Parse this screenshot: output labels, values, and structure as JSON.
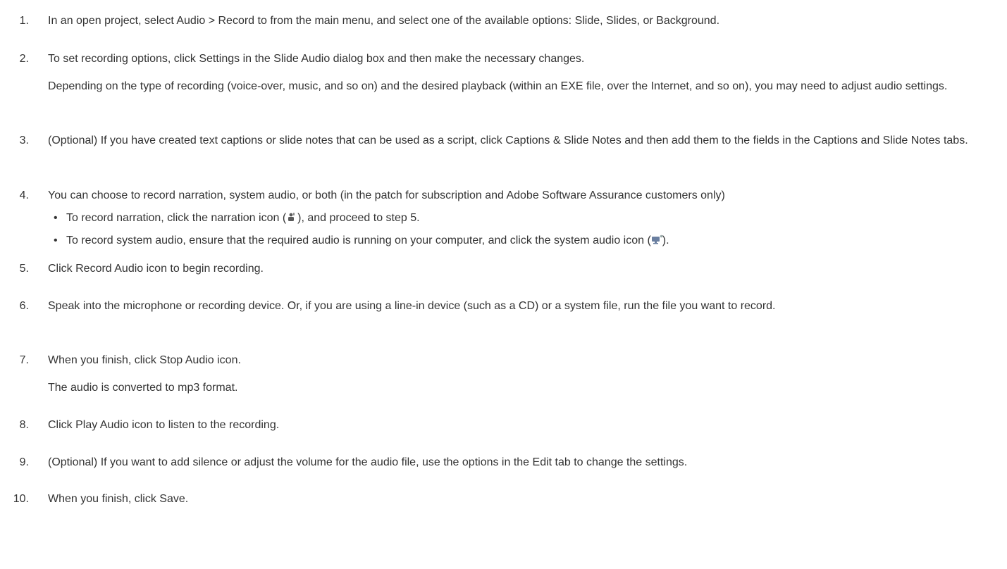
{
  "steps": [
    {
      "num": "1.",
      "text": "In an open project, select Audio > Record to from the main menu, and select one of the available options: Slide, Slides, or Background."
    },
    {
      "num": "2.",
      "text": "To set recording options, click Settings in the Slide Audio dialog box and then make the necessary changes.",
      "note": "Depending on the type of recording (voice-over, music, and so on) and the desired playback (within an EXE file, over the Internet, and so on), you may need to adjust audio settings."
    },
    {
      "num": "3.",
      "text": "(Optional) If you have created text captions or slide notes that can be used as a script, click Captions & Slide Notes and then add them to the fields in the Captions and Slide Notes tabs."
    },
    {
      "num": "4.",
      "text": "You can choose to record narration, system audio, or both (in the patch for subscription and Adobe Software Assurance customers only)",
      "bullets": [
        {
          "before": "To record narration, click the narration icon (",
          "icon": "narration-icon",
          "after": "), and proceed to step 5."
        },
        {
          "before": "To record system audio, ensure that the required audio is running on your computer, and click the system audio icon (",
          "icon": "system-audio-icon",
          "after": ")."
        }
      ]
    },
    {
      "num": "5.",
      "text": "Click Record Audio icon to begin recording."
    },
    {
      "num": "6.",
      "text": "Speak into the microphone or recording device. Or, if you are using a line-in device (such as a CD) or a system file, run the file you want to record."
    },
    {
      "num": "7.",
      "text": "When you finish, click Stop Audio icon.",
      "note": "The audio is converted to mp3 format."
    },
    {
      "num": "8.",
      "text": "Click Play Audio icon to listen to the recording."
    },
    {
      "num": "9.",
      "text": "(Optional) If you want to add silence or adjust the volume for the audio file, use the options in the Edit tab to change the settings."
    },
    {
      "num": "10.",
      "text": "When you finish, click Save."
    }
  ],
  "bullet_char": "•",
  "colors": {
    "text": "#333333",
    "background": "#ffffff"
  }
}
